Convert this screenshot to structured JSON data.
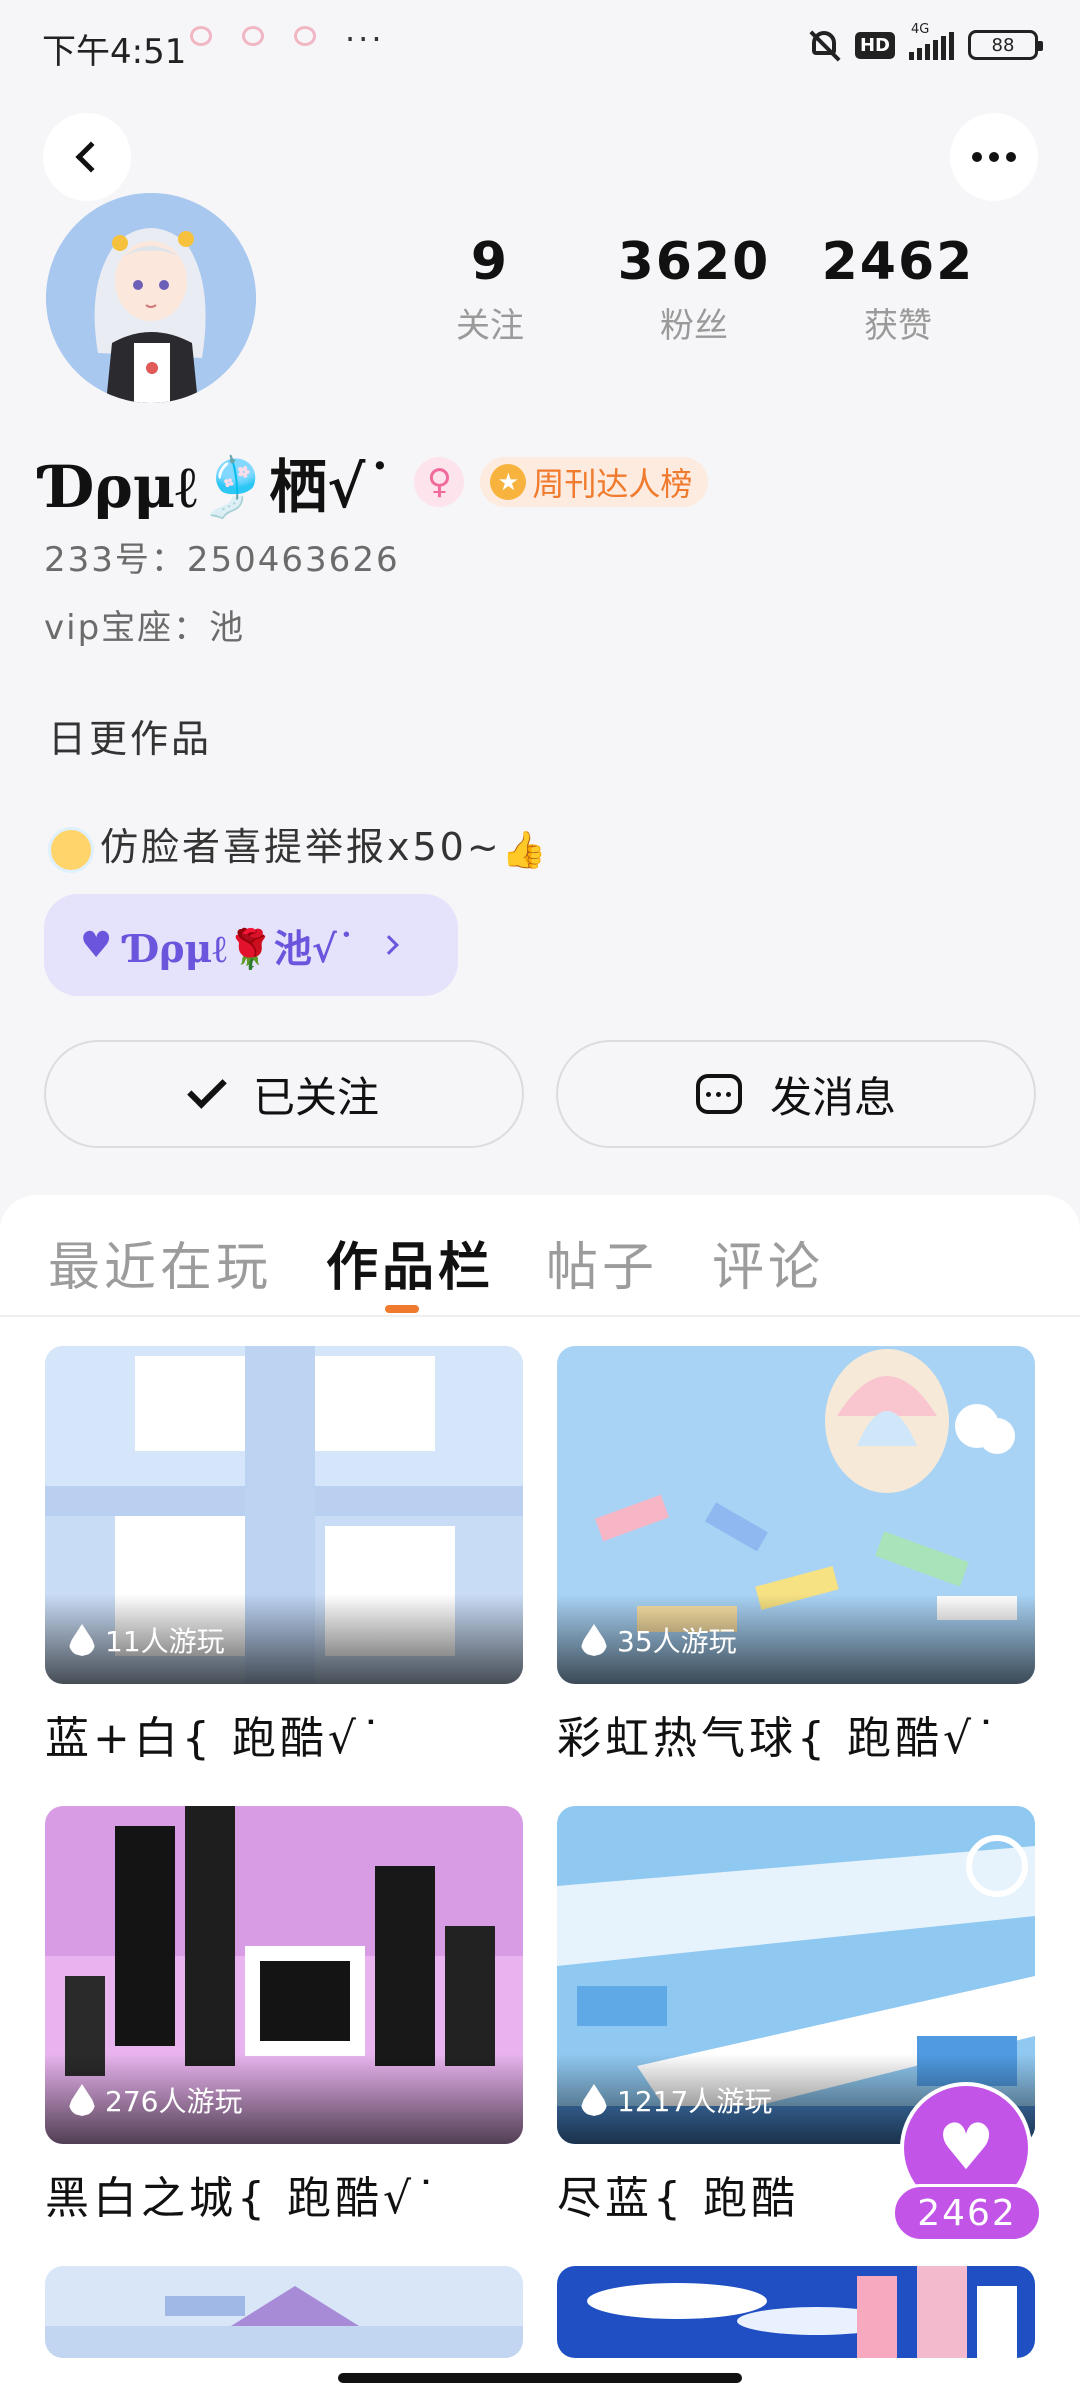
{
  "status": {
    "time": "下午4:51",
    "more": "···",
    "hd": "HD",
    "network": "4G",
    "battery": "88"
  },
  "profile": {
    "name": "Ɗρμℓ🎐栖√˙",
    "gender_symbol": "♀",
    "rank_badge": "周刊达人榜",
    "id_line": "233号：250463626",
    "vip_line": "vip宝座：池",
    "bio_line1": "日更作品",
    "bio_line2": "仿脸者喜提举报x50~",
    "fan_group": "Ɗρμℓ🌹池√˙"
  },
  "stats": [
    {
      "value": "9",
      "label": "关注"
    },
    {
      "value": "3620",
      "label": "粉丝"
    },
    {
      "value": "2462",
      "label": "获赞"
    }
  ],
  "actions": {
    "follow": "已关注",
    "message": "发消息"
  },
  "tabs": [
    "最近在玩",
    "作品栏",
    "帖子",
    "评论"
  ],
  "active_tab": "作品栏",
  "works": [
    {
      "title": "蓝+白{ 跑酷√˙",
      "plays": "11人游玩"
    },
    {
      "title": "彩虹热气球{ 跑酷√˙",
      "plays": "35人游玩"
    },
    {
      "title": "黑白之城{ 跑酷√˙",
      "plays": "276人游玩"
    },
    {
      "title": "尽蓝{ 跑酷",
      "plays": "1217人游玩"
    }
  ],
  "float_like": {
    "count": "2462"
  },
  "colors": {
    "accent": "#f07a2d",
    "fan_group": "#6a55dc",
    "like_button": "#c354e8"
  }
}
